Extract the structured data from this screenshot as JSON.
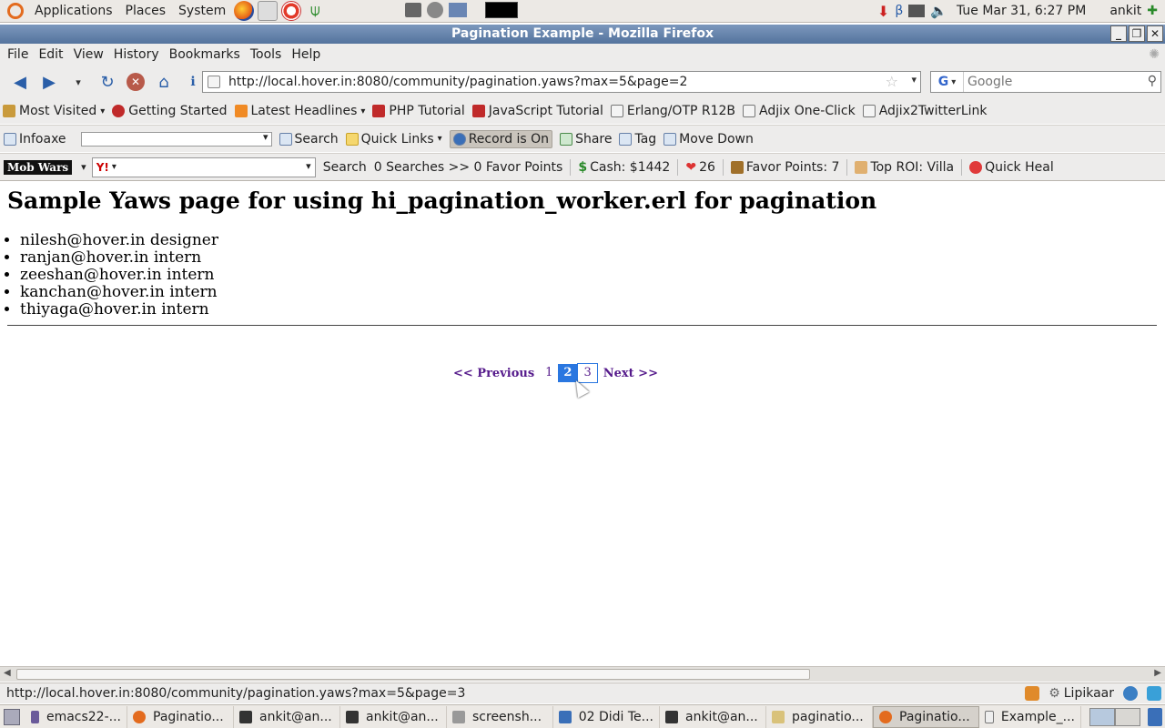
{
  "top_panel": {
    "menus": [
      "Applications",
      "Places",
      "System"
    ],
    "datetime": "Tue Mar 31,  6:27 PM",
    "user": "ankit"
  },
  "window": {
    "title": "Pagination Example - Mozilla Firefox"
  },
  "menubar": {
    "items": [
      "File",
      "Edit",
      "View",
      "History",
      "Bookmarks",
      "Tools",
      "Help"
    ]
  },
  "navbar": {
    "url": "http://local.hover.in:8080/community/pagination.yaws?max=5&page=2",
    "search_engine": "G",
    "search_placeholder": "Google"
  },
  "bookmarks": {
    "items": [
      "Most Visited",
      "Getting Started",
      "Latest Headlines",
      "PHP Tutorial",
      "JavaScript Tutorial",
      "Erlang/OTP R12B",
      "Adjix One-Click",
      "Adjix2TwitterLink"
    ]
  },
  "toolbar2": {
    "infoaxe": "Infoaxe",
    "search": "Search",
    "quick_links": "Quick Links",
    "record": "Record is On",
    "share": "Share",
    "tag": "Tag",
    "move_down": "Move Down"
  },
  "toolbar3": {
    "game": "Mob Wars",
    "yahoo": "Y!",
    "search": "Search",
    "searches": "0 Searches >> 0 Favor Points",
    "cash": "Cash: $1442",
    "hearts": "26",
    "favor": "Favor Points: 7",
    "roi": "Top ROI: Villa",
    "quick_heal": "Quick Heal"
  },
  "page": {
    "heading": "Sample Yaws page for using hi_pagination_worker.erl for pagination",
    "list": [
      "nilesh@hover.in designer",
      "ranjan@hover.in intern",
      "zeeshan@hover.in intern",
      "kanchan@hover.in intern",
      "thiyaga@hover.in intern"
    ],
    "pager": {
      "previous": "<< Previous",
      "pages": [
        "1",
        "2",
        "3"
      ],
      "current": "2",
      "next": "Next >>"
    }
  },
  "statusbar": {
    "text": "http://local.hover.in:8080/community/pagination.yaws?max=5&page=3",
    "lipikaar": "Lipikaar"
  },
  "taskbar": {
    "tasks": [
      "emacs22-...",
      "Paginatio...",
      "ankit@an...",
      "ankit@an...",
      "screensh...",
      "02 Didi Te...",
      "ankit@an...",
      "paginatio...",
      "Paginatio...",
      "Example_..."
    ]
  }
}
